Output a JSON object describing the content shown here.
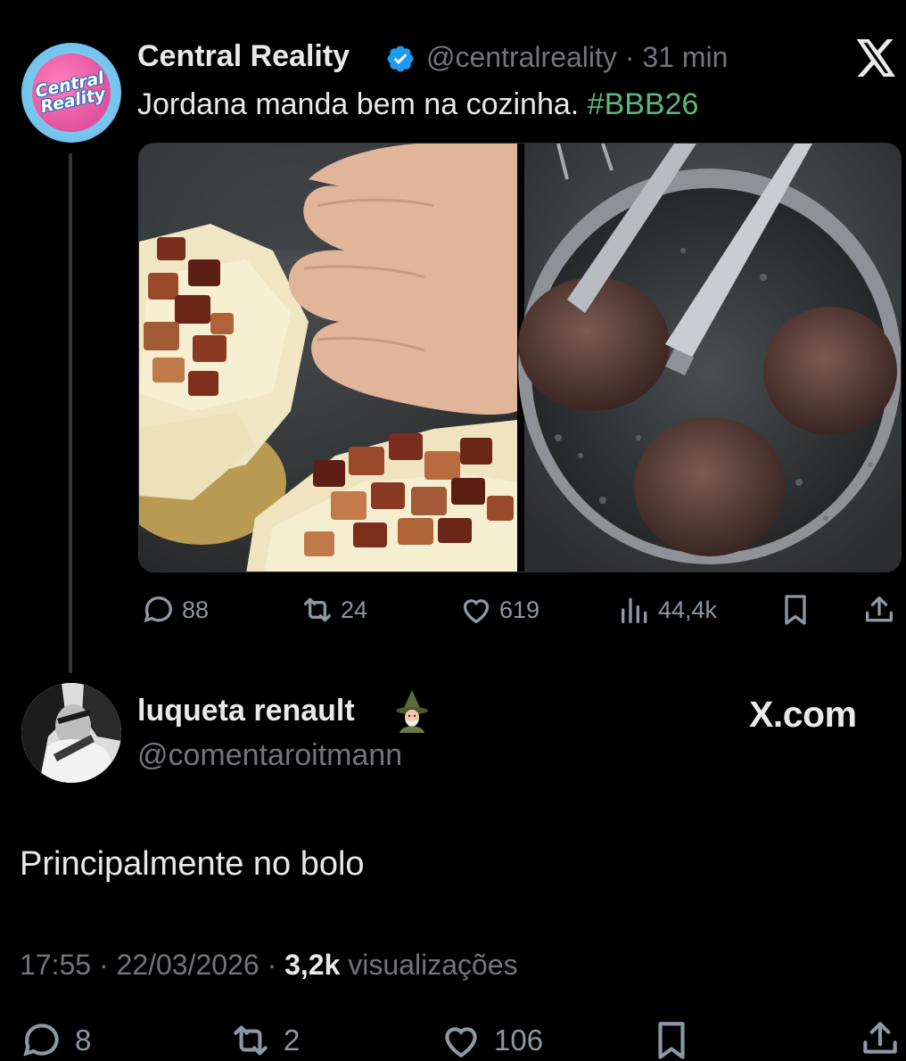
{
  "quoted_tweet": {
    "avatar_text_line1": "Central",
    "avatar_text_line2": "Reality",
    "author_name": "Central Reality",
    "handle": "@centralreality",
    "time": "· 31 min",
    "text": "Jordana manda bem na cozinha. ",
    "hashtag": "#BBB26",
    "actions": {
      "replies": "88",
      "retweets": "24",
      "likes": "619",
      "views": "44,4k"
    }
  },
  "reply_tweet": {
    "author_name": "luqueta renault",
    "handle": "@comentaroitmann",
    "watermark": "X.com",
    "text": "Principalmente no bolo",
    "timestamp": "17:55 · 22/03/2026 · ",
    "views_count": "3,2k",
    "views_label": " visualizações",
    "actions": {
      "replies": "8",
      "retweets": "2",
      "likes": "106"
    }
  },
  "colors": {
    "background": "#000000",
    "text_primary": "#e7e9ea",
    "text_secondary": "#71767b",
    "hashtag": "#5bb77a",
    "verified": "#1d9bf0"
  },
  "icons": [
    "verified-badge-icon",
    "x-logo-icon",
    "reply-icon",
    "retweet-icon",
    "like-icon",
    "views-icon",
    "bookmark-icon",
    "share-icon",
    "wizard-emoji-icon"
  ]
}
